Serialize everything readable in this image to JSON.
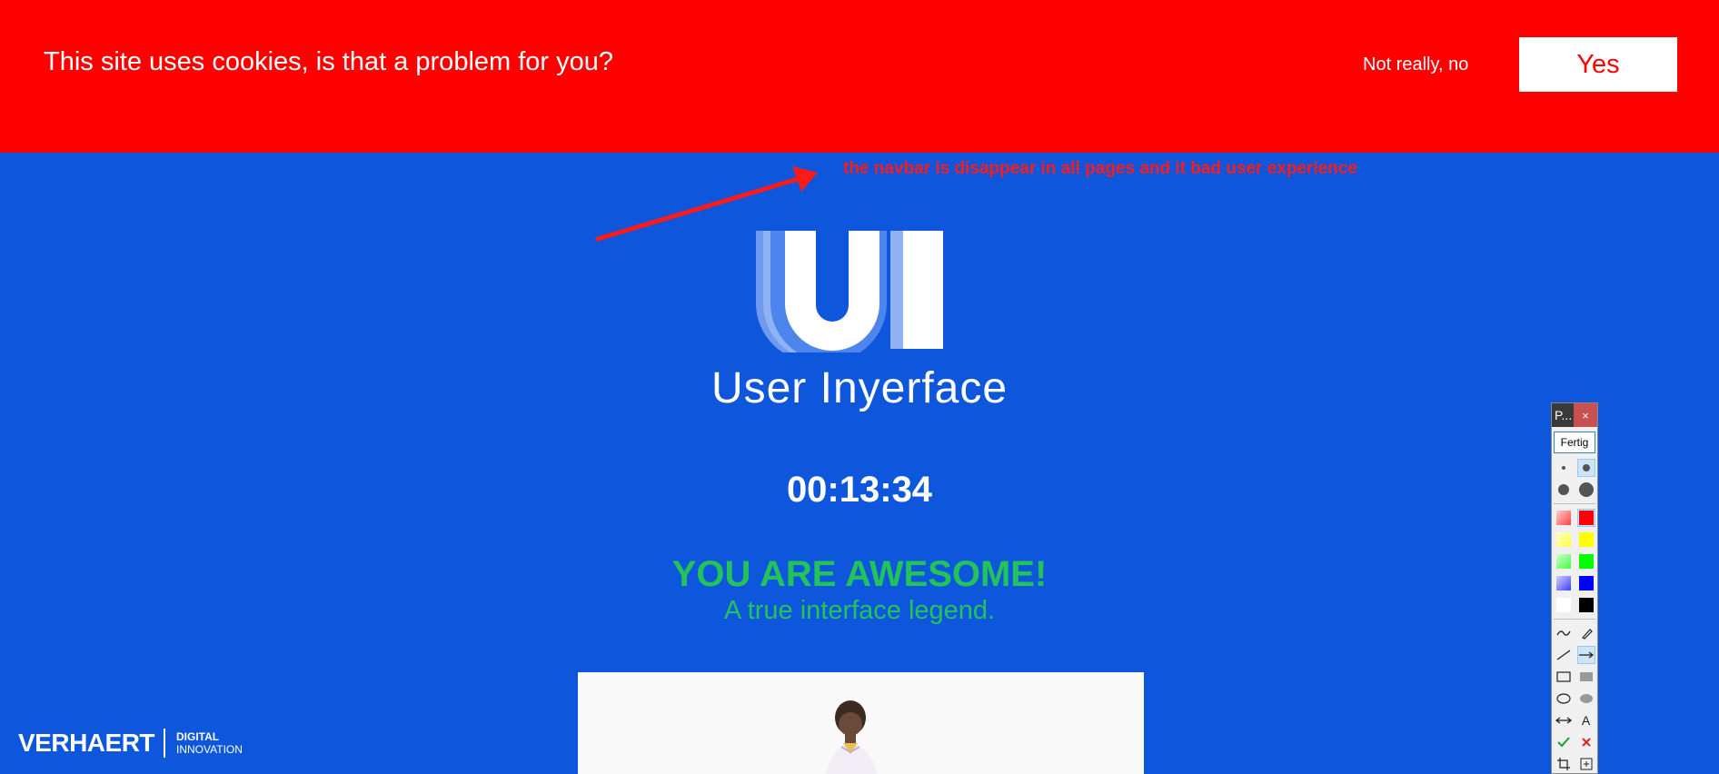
{
  "cookie_banner": {
    "message": "This site uses cookies, is that a problem for you?",
    "decline_label": "Not really, no",
    "accept_label": "Yes"
  },
  "annotation": {
    "text": "the navbar is disappear in all pages and it bad user experience"
  },
  "logo": {
    "mark": "UI",
    "name": "User Inyerface"
  },
  "timer": "00:13:34",
  "result": {
    "headline": "YOU ARE AWESOME!",
    "subline": "A true interface legend."
  },
  "footer_logo": {
    "name": "VERHAERT",
    "sub_line1": "DIGITAL",
    "sub_line2": "INNOVATION"
  },
  "palette": {
    "title": "P...",
    "close_icon": "×",
    "done_label": "Fertig",
    "colors": [
      "#ff0000",
      "#ffff00",
      "#00ff00",
      "#0000ff",
      "#000000"
    ],
    "tools": [
      "freehand-icon",
      "highlighter-icon",
      "line-icon",
      "arrow-icon",
      "rectangle-icon",
      "filled-rectangle-icon",
      "ellipse-icon",
      "filled-ellipse-icon",
      "double-arrow-icon",
      "text-icon",
      "confirm-icon",
      "delete-icon",
      "crop-icon",
      "zoom-icon"
    ],
    "text_tool_glyph": "A"
  },
  "colors": {
    "background": "#0e57dc",
    "banner": "#ff0000",
    "success": "#22c45a"
  }
}
